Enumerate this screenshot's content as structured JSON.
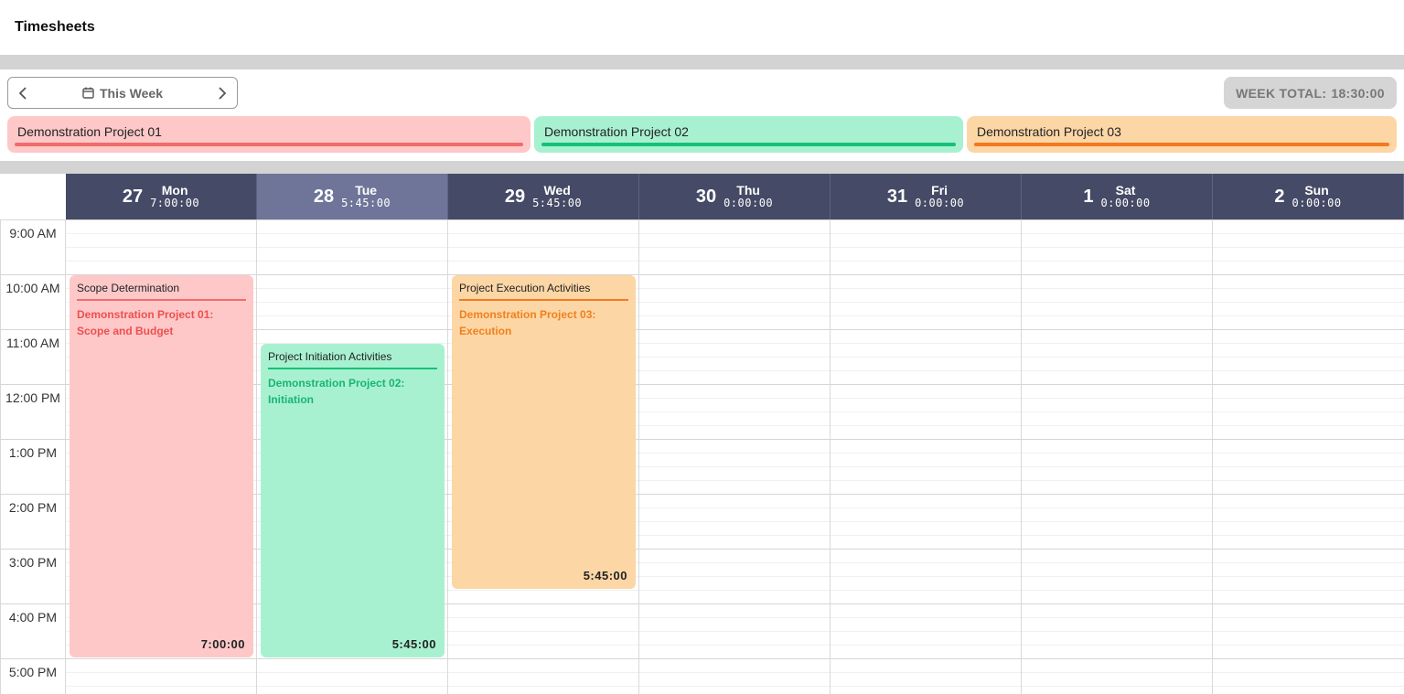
{
  "header": {
    "title": "Timesheets"
  },
  "week_nav": {
    "label": "This Week",
    "prev_icon": "chevron-left-icon",
    "next_icon": "chevron-right-icon",
    "calendar_icon": "calendar-icon"
  },
  "week_total": {
    "label": "WEEK TOTAL:",
    "value": "18:30:00"
  },
  "projects": [
    {
      "name": "Demonstration Project 01",
      "bg": "#fec8c8",
      "bar": "#f26b6b"
    },
    {
      "name": "Demonstration Project 02",
      "bg": "#a8f1d0",
      "bar": "#14c178"
    },
    {
      "name": "Demonstration Project 03",
      "bg": "#fdd6a6",
      "bar": "#f3791e"
    }
  ],
  "days": [
    {
      "num": "27",
      "name": "Mon",
      "total": "7:00:00",
      "today": false
    },
    {
      "num": "28",
      "name": "Tue",
      "total": "5:45:00",
      "today": true
    },
    {
      "num": "29",
      "name": "Wed",
      "total": "5:45:00",
      "today": false
    },
    {
      "num": "30",
      "name": "Thu",
      "total": "0:00:00",
      "today": false
    },
    {
      "num": "31",
      "name": "Fri",
      "total": "0:00:00",
      "today": false
    },
    {
      "num": "1",
      "name": "Sat",
      "total": "0:00:00",
      "today": false
    },
    {
      "num": "2",
      "name": "Sun",
      "total": "0:00:00",
      "today": false
    }
  ],
  "hours": [
    "9:00 AM",
    "10:00 AM",
    "11:00 AM",
    "12:00 PM",
    "1:00 PM",
    "2:00 PM",
    "3:00 PM",
    "4:00 PM",
    "5:00 PM"
  ],
  "events": [
    {
      "day": 0,
      "start": 10,
      "end": 17,
      "name": "Scope Determination",
      "project": "Demonstration Project 01: Scope and Budget",
      "duration": "7:00:00",
      "bg": "#fec8c8",
      "accent": "#f26b6b",
      "text": "#ee4f4f"
    },
    {
      "day": 1,
      "start": 11.25,
      "end": 17,
      "name": "Project Initiation Activities",
      "project": "Demonstration Project 02: Initiation",
      "duration": "5:45:00",
      "bg": "#a8f1d0",
      "accent": "#14c178",
      "text": "#18b573"
    },
    {
      "day": 2,
      "start": 10,
      "end": 15.75,
      "name": "Project Execution Activities",
      "project": "Demonstration Project 03: Execution",
      "duration": "5:45:00",
      "bg": "#fdd6a6",
      "accent": "#f3791e",
      "text": "#f0801c"
    }
  ]
}
